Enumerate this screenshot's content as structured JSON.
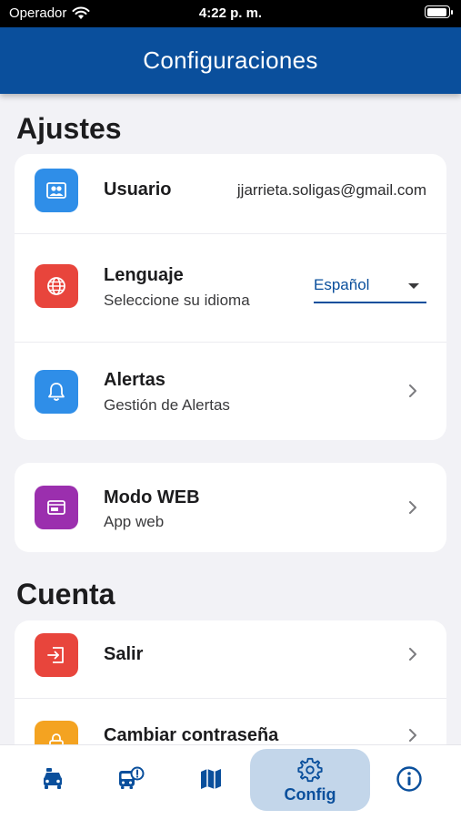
{
  "status_bar": {
    "carrier": "Operador",
    "time": "4:22 p. m."
  },
  "header": {
    "title": "Configuraciones"
  },
  "sections": {
    "ajustes": {
      "title": "Ajustes",
      "usuario": {
        "label": "Usuario",
        "value": "jjarrieta.soligas@gmail.com"
      },
      "lenguaje": {
        "label": "Lenguaje",
        "subtitle": "Seleccione su idioma",
        "selected": "Español"
      },
      "alertas": {
        "label": "Alertas",
        "subtitle": "Gestión de Alertas"
      },
      "modo_web": {
        "label": "Modo WEB",
        "subtitle": "App web"
      }
    },
    "cuenta": {
      "title": "Cuenta",
      "salir": {
        "label": "Salir"
      },
      "cambiar": {
        "label": "Cambiar contraseña"
      }
    }
  },
  "tab_bar": {
    "active_label": "Config",
    "icons": [
      "vehicle-icon",
      "bus-alert-icon",
      "map-icon",
      "gear-icon",
      "info-icon"
    ]
  },
  "colors": {
    "header": "#0a4f9c",
    "accent": "#0a4f9c",
    "user_icon": "#2f8ee8",
    "language_icon": "#e8453c",
    "alert_icon": "#2f8ee8",
    "web_icon": "#9b2fae",
    "exit_icon": "#e8453c",
    "password_icon": "#f4a321",
    "active_tab_bg": "#c3d6ea"
  }
}
